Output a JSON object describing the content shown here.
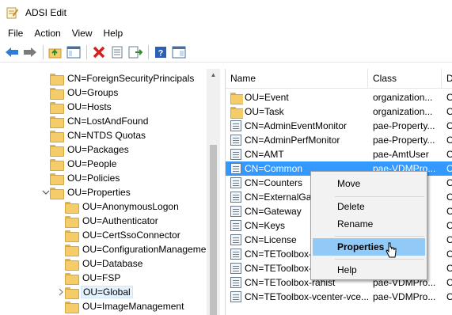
{
  "window": {
    "title": "ADSI Edit",
    "icon": "adsi-edit-icon"
  },
  "menu": [
    "File",
    "Action",
    "View",
    "Help"
  ],
  "toolbar": [
    {
      "name": "back-arrow-icon",
      "enabled": true
    },
    {
      "name": "forward-arrow-icon",
      "enabled": true
    },
    {
      "name": "up-folder-icon",
      "enabled": true
    },
    {
      "name": "show-hide-tree-icon",
      "enabled": true
    },
    {
      "name": "delete-x-icon",
      "enabled": true
    },
    {
      "name": "properties-sheet-icon",
      "enabled": true
    },
    {
      "name": "export-list-icon",
      "enabled": true
    },
    {
      "name": "help-icon",
      "enabled": true
    },
    {
      "name": "details-view-icon",
      "enabled": true
    }
  ],
  "tree": [
    {
      "label": "CN=ForeignSecurityPrincipals",
      "level": 0,
      "expander": ""
    },
    {
      "label": "OU=Groups",
      "level": 0,
      "expander": ""
    },
    {
      "label": "OU=Hosts",
      "level": 0,
      "expander": ""
    },
    {
      "label": "CN=LostAndFound",
      "level": 0,
      "expander": ""
    },
    {
      "label": "CN=NTDS Quotas",
      "level": 0,
      "expander": ""
    },
    {
      "label": "OU=Packages",
      "level": 0,
      "expander": ""
    },
    {
      "label": "OU=People",
      "level": 0,
      "expander": ""
    },
    {
      "label": "OU=Policies",
      "level": 0,
      "expander": ""
    },
    {
      "label": "OU=Properties",
      "level": 0,
      "expander": "expanded"
    },
    {
      "label": "OU=AnonymousLogon",
      "level": 1,
      "expander": ""
    },
    {
      "label": "OU=Authenticator",
      "level": 1,
      "expander": ""
    },
    {
      "label": "OU=CertSsoConnector",
      "level": 1,
      "expander": ""
    },
    {
      "label": "OU=ConfigurationManageme",
      "level": 1,
      "expander": ""
    },
    {
      "label": "OU=Database",
      "level": 1,
      "expander": ""
    },
    {
      "label": "OU=FSP",
      "level": 1,
      "expander": ""
    },
    {
      "label": "OU=Global",
      "level": 1,
      "expander": "collapsed",
      "selected": true
    },
    {
      "label": "OU=ImageManagement",
      "level": 1,
      "expander": ""
    }
  ],
  "list": {
    "columns": [
      "Name",
      "Class",
      "D"
    ],
    "rows": [
      {
        "name": "OU=Event",
        "class": "organization...",
        "d": "O",
        "icon": "folder"
      },
      {
        "name": "OU=Task",
        "class": "organization...",
        "d": "O",
        "icon": "folder"
      },
      {
        "name": "CN=AdminEventMonitor",
        "class": "pae-Property...",
        "d": "C",
        "icon": "object"
      },
      {
        "name": "CN=AdminPerfMonitor",
        "class": "pae-Property...",
        "d": "C",
        "icon": "object"
      },
      {
        "name": "CN=AMT",
        "class": "pae-AmtUser",
        "d": "C",
        "icon": "object"
      },
      {
        "name": "CN=Common",
        "class": "pae-VDMPro...",
        "d": "C",
        "icon": "object",
        "selected": true
      },
      {
        "name": "CN=Counters",
        "class": "",
        "d": "C",
        "icon": "object"
      },
      {
        "name": "CN=ExternalGat",
        "class": "",
        "d": "C",
        "icon": "object"
      },
      {
        "name": "CN=Gateway",
        "class": "",
        "d": "C",
        "icon": "object"
      },
      {
        "name": "CN=Keys",
        "class": "",
        "d": "C",
        "icon": "object"
      },
      {
        "name": "CN=License",
        "class": "",
        "d": "C",
        "icon": "object"
      },
      {
        "name": "CN=TEToolbox-",
        "class": "",
        "d": "C",
        "icon": "object"
      },
      {
        "name": "CN=TEToolbox-",
        "class": "",
        "d": "C",
        "icon": "object"
      },
      {
        "name": "CN=TEToolbox-rahist",
        "class": "pae-VDMPro...",
        "d": "C",
        "icon": "object"
      },
      {
        "name": "CN=TEToolbox-vcenter-vce...",
        "class": "pae-VDMPro...",
        "d": "C",
        "icon": "object"
      }
    ]
  },
  "context_menu": [
    {
      "label": "Move",
      "type": "item"
    },
    {
      "type": "separator"
    },
    {
      "label": "Delete",
      "type": "item"
    },
    {
      "label": "Rename",
      "type": "item"
    },
    {
      "type": "separator"
    },
    {
      "label": "Properties",
      "type": "item",
      "highlight": true
    },
    {
      "type": "separator"
    },
    {
      "label": "Help",
      "type": "item"
    }
  ]
}
